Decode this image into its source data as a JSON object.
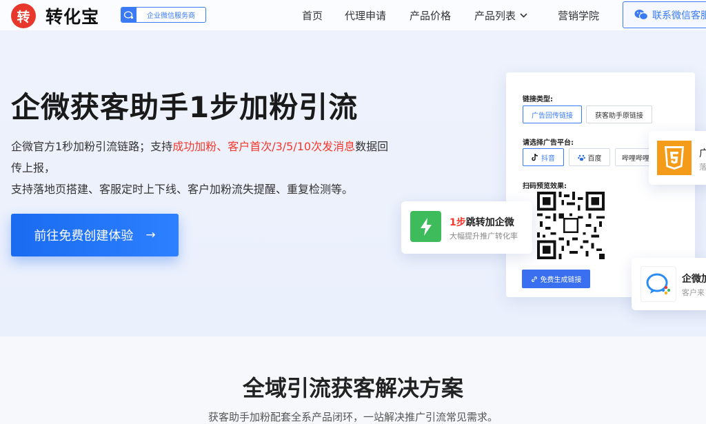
{
  "brand": {
    "logo_char": "转",
    "name": "转化宝",
    "badge": "企业微信服务商",
    "color": "#e8372b"
  },
  "nav": {
    "items": [
      "首页",
      "代理申请",
      "产品价格",
      "产品列表",
      "营销学院"
    ],
    "contact": "联系微信客服"
  },
  "hero": {
    "title": "企微获客助手1步加粉引流",
    "desc": {
      "part1": "企微官方1秒加粉引流链路；支持",
      "highlight": "成功加粉、客户首次/3/5/10次发消息",
      "part2": "数据回传上报，",
      "line2": "支持落地页搭建、客服定时上下线、客户加粉流失提醒、重复检测等。"
    },
    "cta": "前往免费创建体验"
  },
  "panel": {
    "link_type_label": "链接类型:",
    "link_types": [
      "广告回传链接",
      "获客助手原链接"
    ],
    "platform_label": "请选择广告平台:",
    "platforms": [
      "抖音",
      "百度",
      "哔哩哔哩"
    ],
    "preview_label": "扫码预览效果:",
    "generate": "免费生成链接"
  },
  "float_cards": {
    "jump": {
      "num": "1步",
      "title": "跳转加企微",
      "sub": "大幅提升推广转化率"
    },
    "html5": {
      "title": "广",
      "sub": "落"
    },
    "wecom": {
      "title": "企微加",
      "sub": "客户来"
    }
  },
  "section2": {
    "title": "全域引流获客解决方案",
    "subtitle": "获客助手加粉配套全系产品闭环，一站解决推广引流常见需求。"
  },
  "colors": {
    "accent": "#3a7bf5",
    "highlight": "#f5372b",
    "success": "#3ebb5a",
    "html5": "#f59b1a"
  }
}
